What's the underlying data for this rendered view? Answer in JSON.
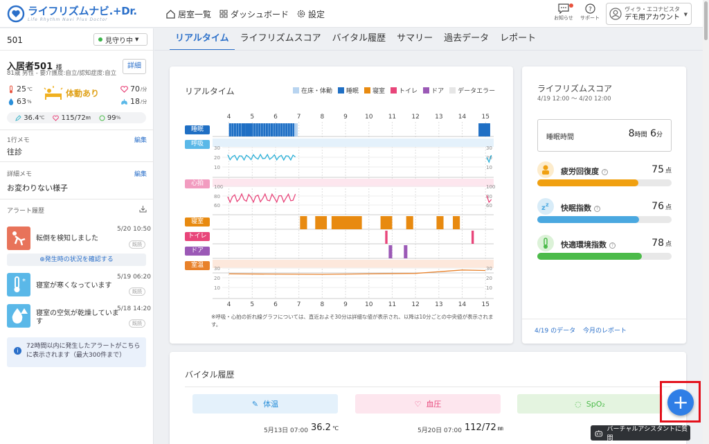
{
  "app": {
    "title": "ライフリズムナビ.+Dr.",
    "subtitle": "Life Rhythm Navi Plus Doctor"
  },
  "nav": [
    {
      "label": "居室一覧",
      "icon": "home-icon"
    },
    {
      "label": "ダッシュボード",
      "icon": "grid-icon"
    },
    {
      "label": "設定",
      "icon": "gear-icon"
    }
  ],
  "header": {
    "notice": "お知らせ",
    "support": "サポート",
    "account_org": "ヴィラ・エコナビスタ",
    "account_name": "デモ用アカウント"
  },
  "sidebar": {
    "room": "501",
    "watch_status": "見守り中",
    "resident_name": "入居者501",
    "resident_suffix": "様",
    "resident_info": "81歳 男性 - 要介護度:自立/認知症度:自立",
    "detail_button": "詳細",
    "room_temp": "25",
    "room_temp_unit": "℃",
    "humidity": "63",
    "humidity_unit": "%",
    "body_status": "体動あり",
    "heart": "70",
    "heart_unit": "/分",
    "breath": "18",
    "breath_unit": "/分",
    "body_temp": "36.4",
    "body_temp_unit": "℃",
    "bp": "115/72",
    "bp_unit": "㎜",
    "spo2": "99",
    "spo2_unit": "%",
    "memo1_label": "1行メモ",
    "memo1_edit": "編集",
    "memo1": "往診",
    "memo2_label": "詳細メモ",
    "memo2_edit": "編集",
    "memo2": "お変わりない様子",
    "alert_label": "アラート履歴",
    "alerts": [
      {
        "text": "転倒を検知しました",
        "time": "5/20 10:50",
        "tag": "既読",
        "color": "#e8735a"
      },
      {
        "text": "寝室が寒くなっています",
        "time": "5/19 06:20",
        "tag": "既読",
        "color": "#5ab8e8"
      },
      {
        "text": "寝室の空気が乾燥していま す",
        "time": "5/18 14:20",
        "tag": "既読",
        "color": "#5ab8e8"
      }
    ],
    "confirm_button": "発生時の状況を確認する",
    "info": "72時間以内に発生したアラートがこちらに表示されます（最大300件まで）"
  },
  "tabs": [
    {
      "label": "リアルタイム",
      "active": true
    },
    {
      "label": "ライフリズムスコア"
    },
    {
      "label": "バイタル履歴"
    },
    {
      "label": "サマリー"
    },
    {
      "label": "過去データ"
    },
    {
      "label": "レポート"
    }
  ],
  "realtime": {
    "title": "リアルタイム",
    "legend": [
      {
        "label": "在床・体動",
        "color": "#b8d4f0"
      },
      {
        "label": "睡眠",
        "color": "#1f6fc4"
      },
      {
        "label": "寝室",
        "color": "#e88a10"
      },
      {
        "label": "トイレ",
        "color": "#e8457a"
      },
      {
        "label": "ドア",
        "color": "#9b59b6"
      },
      {
        "label": "データエラー",
        "color": "#e6e6e6"
      }
    ],
    "rows": [
      "睡眠",
      "呼吸",
      "心拍",
      "寝室",
      "トイレ",
      "ドア",
      "室温"
    ],
    "hours": [
      "4",
      "5",
      "6",
      "7",
      "8",
      "9",
      "10",
      "11",
      "12",
      "13",
      "14",
      "15"
    ],
    "breath_scale": [
      "30",
      "20",
      "10"
    ],
    "heart_scale": [
      "100",
      "80",
      "60"
    ],
    "temp_scale": [
      "30",
      "20",
      "10"
    ],
    "note": "※呼吸・心拍の折れ線グラフについては、直近およそ30分は詳細な値が表示され、以降は10分ごとの中央値が表示されます。"
  },
  "score": {
    "title": "ライフリズムスコア",
    "range": "4/19 12:00 〜 4/20 12:00",
    "sleep_label": "睡眠時間",
    "sleep_h": "8",
    "sleep_h_unit": "時間",
    "sleep_m": "6",
    "sleep_m_unit": "分",
    "items": [
      {
        "name": "疲労回復度",
        "value": "75",
        "unit": "点",
        "pct": 0.75,
        "color": "#f0a010",
        "bg": "#fdeccc"
      },
      {
        "name": "快眠指数",
        "value": "76",
        "unit": "点",
        "pct": 0.76,
        "color": "#4aa8e0",
        "bg": "#d8ecf8"
      },
      {
        "name": "快適環境指数",
        "value": "78",
        "unit": "点",
        "pct": 0.78,
        "color": "#4cbb4a",
        "bg": "#dcf2d8"
      }
    ],
    "link1": "4/19 のデータ",
    "link2": "今月のレポート"
  },
  "vital": {
    "title": "バイタル履歴",
    "items": [
      {
        "label": "体温",
        "date": "5月13日 07:00",
        "value": "36.2",
        "unit": "℃"
      },
      {
        "label": "血圧",
        "date": "5月20日 07:00",
        "value": "112/72",
        "unit": "㎜"
      },
      {
        "label": "SpO₂"
      }
    ]
  },
  "assistant": "バーチャルアシスタントに質問",
  "chart_data": {
    "type": "table",
    "x": [
      4,
      5,
      6,
      7,
      8,
      9,
      10,
      11,
      12,
      13,
      14,
      15
    ],
    "sleep": [
      [
        4,
        4.7
      ],
      [
        4.7,
        5.0
      ],
      [
        5.0,
        6.8
      ],
      [
        14.7,
        15.2
      ]
    ],
    "bedroom": [
      [
        7.05,
        7.35
      ],
      [
        7.7,
        8.2
      ],
      [
        8.4,
        9.7
      ],
      [
        10.5,
        11.0
      ],
      [
        11.6,
        11.9
      ],
      [
        12.9,
        13.2
      ],
      [
        13.6,
        13.9
      ]
    ],
    "toilet": [
      [
        10.7,
        10.8
      ],
      [
        14.4,
        14.5
      ]
    ],
    "door": [
      [
        10.85,
        11.0
      ],
      [
        11.5,
        11.65
      ]
    ],
    "temp": [
      [
        4,
        24
      ],
      [
        8,
        23.5
      ],
      [
        10,
        24
      ],
      [
        12,
        24.5
      ],
      [
        14,
        28
      ],
      [
        15,
        27.5
      ]
    ]
  }
}
